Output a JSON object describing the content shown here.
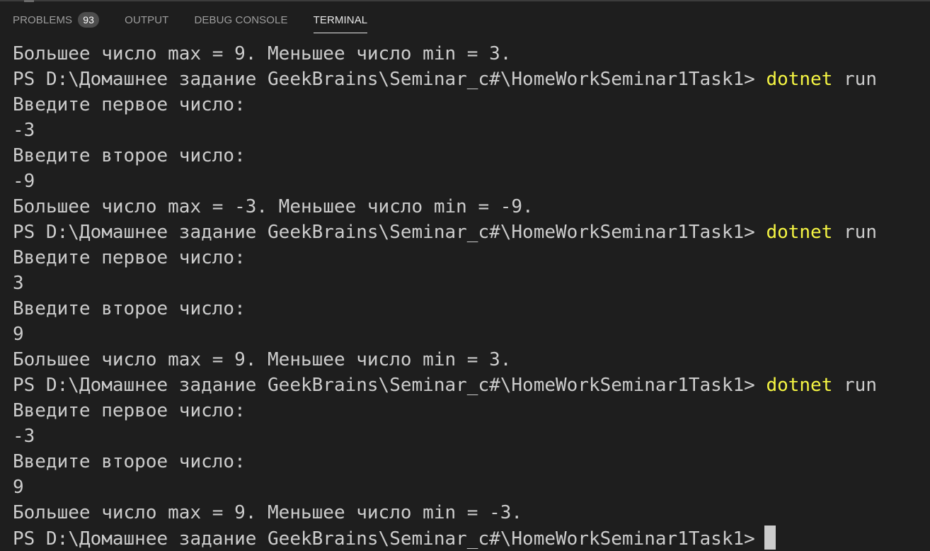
{
  "tabs": {
    "problems_label": "PROBLEMS",
    "problems_count": "93",
    "output_label": "OUTPUT",
    "debug_console_label": "DEBUG CONSOLE",
    "terminal_label": "TERMINAL",
    "active": "TERMINAL"
  },
  "colors": {
    "background": "#1e1e1e",
    "text": "#cccccc",
    "command": "#f5f543"
  },
  "terminal": {
    "lines": [
      "Большее число max = 9. Меньшее число min = 3.",
      "PS D:\\Домашнее задание GeekBrains\\Seminar_c#\\HomeWorkSeminar1Task1>",
      "Введите первое число:",
      "-3",
      "Введите второе число:",
      "-9",
      "Большее число max = -3. Меньшее число min = -9.",
      "PS D:\\Домашнее задание GeekBrains\\Seminar_c#\\HomeWorkSeminar1Task1>",
      "Введите первое число:",
      "3",
      "Введите второе число:",
      "9",
      "Большее число max = 9. Меньшее число min = 3.",
      "PS D:\\Домашнее задание GeekBrains\\Seminar_c#\\HomeWorkSeminar1Task1>",
      "Введите первое число:",
      "-3",
      "Введите второе число:",
      "9",
      "Большее число max = 9. Меньшее число min = -3.",
      "PS D:\\Домашнее задание GeekBrains\\Seminar_c#\\HomeWorkSeminar1Task1>"
    ],
    "commands": {
      "1": {
        "program": "dotnet",
        "args": " run"
      },
      "7": {
        "program": "dotnet",
        "args": " run"
      },
      "13": {
        "program": "dotnet",
        "args": " run"
      }
    }
  }
}
